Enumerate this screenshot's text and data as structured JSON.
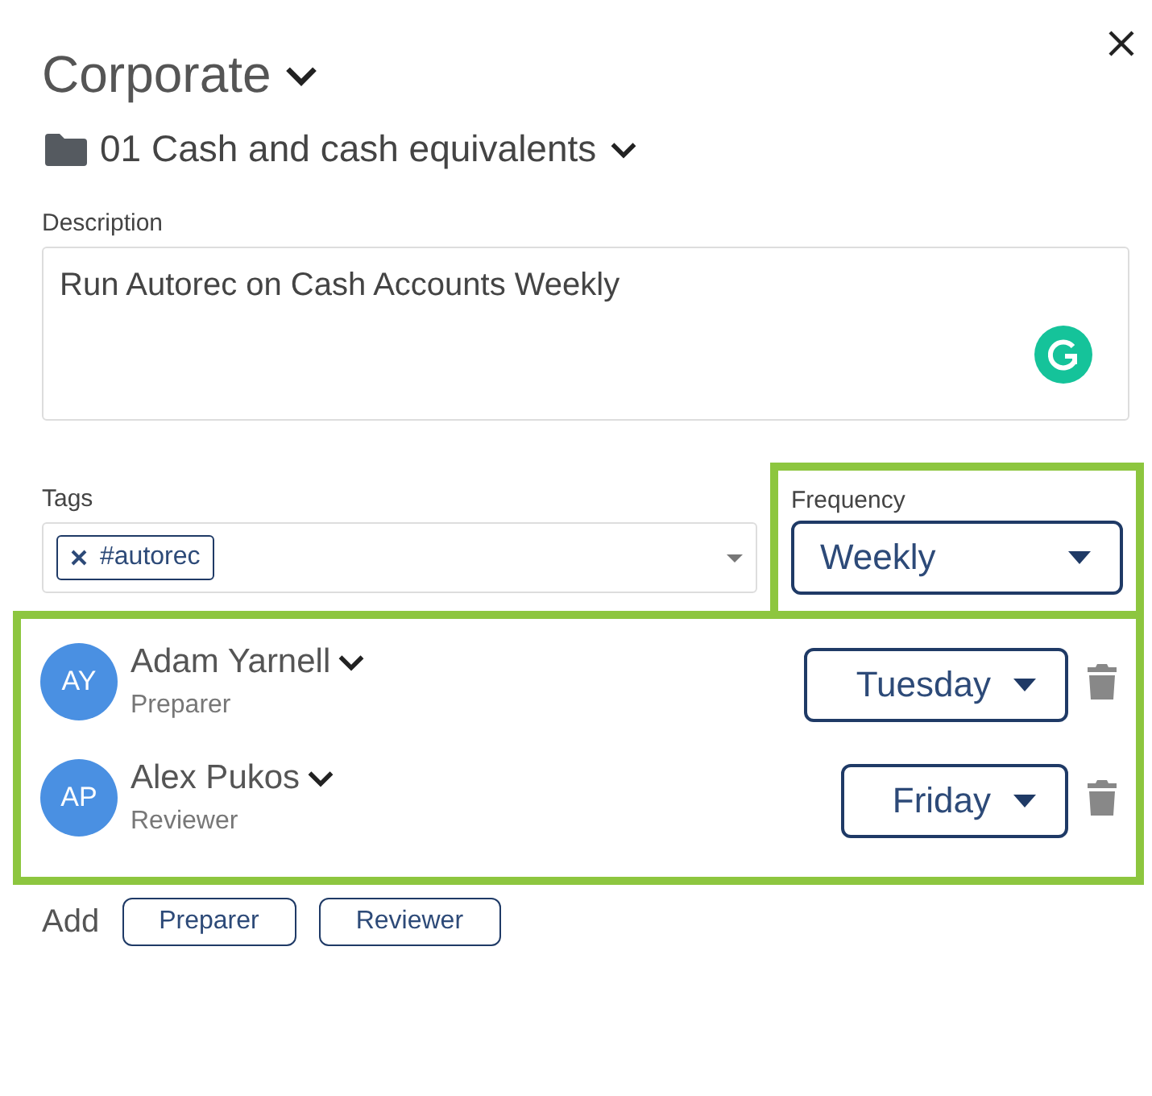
{
  "header": {
    "title": "Corporate",
    "folder": "01 Cash and cash equivalents"
  },
  "description": {
    "label": "Description",
    "value": "Run Autorec on Cash Accounts Weekly"
  },
  "tags": {
    "label": "Tags",
    "items": [
      {
        "text": "#autorec"
      }
    ]
  },
  "frequency": {
    "label": "Frequency",
    "value": "Weekly",
    "highlighted": true
  },
  "assignees": {
    "highlighted": true,
    "items": [
      {
        "initials": "AY",
        "name": "Adam Yarnell",
        "role": "Preparer",
        "day": "Tuesday"
      },
      {
        "initials": "AP",
        "name": "Alex Pukos",
        "role": "Reviewer",
        "day": "Friday"
      }
    ]
  },
  "add": {
    "label": "Add",
    "buttons": [
      "Preparer",
      "Reviewer"
    ]
  }
}
